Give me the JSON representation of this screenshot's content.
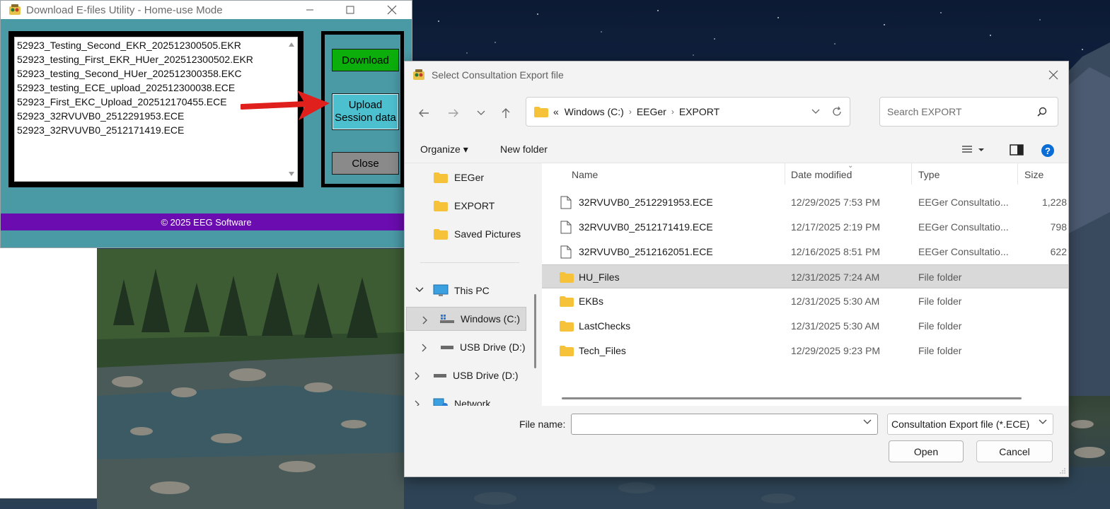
{
  "utility": {
    "title": "Download E-files Utility - Home-use Mode",
    "files": [
      "52923_Testing_Second_EKR_202512300505.EKR",
      "52923_testing_First_EKR_HUer_202512300502.EKR",
      "52923_testing_Second_HUer_202512300358.EKC",
      "52923_testing_ECE_upload_202512300038.ECE",
      "52923_First_EKC_Upload_202512170455.ECE",
      "52923_32RVUVB0_2512291953.ECE",
      "52923_32RVUVB0_2512171419.ECE"
    ],
    "download_label": "Download",
    "upload_label_1": "Upload",
    "upload_label_2": "Session data",
    "close_label": "Close",
    "footer": "© 2025 EEG Software",
    "colors": {
      "body": "#4a9aa6",
      "footer": "#6b0cb0",
      "download": "#0cae0c",
      "upload": "#4dc0d0",
      "arrow": "#e0201c"
    }
  },
  "dialog": {
    "title": "Select Consultation Export file",
    "breadcrumb": [
      "Windows (C:)",
      "EEGer",
      "EXPORT"
    ],
    "breadcrumb_prefix": "«",
    "search_placeholder": "Search EXPORT",
    "organize_label": "Organize ▾",
    "new_folder_label": "New folder",
    "nav_items": [
      {
        "label": "EEGer",
        "icon": "folder-icon"
      },
      {
        "label": "EXPORT",
        "icon": "folder-icon"
      },
      {
        "label": "Saved Pictures",
        "icon": "folder-icon"
      },
      {
        "label": "This PC",
        "icon": "computer-icon"
      },
      {
        "label": "Windows (C:)",
        "icon": "drive-icon"
      },
      {
        "label": "USB Drive (D:)",
        "icon": "usb-drive-icon"
      },
      {
        "label": "USB Drive (D:)",
        "icon": "usb-drive-icon"
      },
      {
        "label": "Network",
        "icon": "network-icon"
      }
    ],
    "columns": {
      "name": "Name",
      "date": "Date modified",
      "type": "Type",
      "size": "Size"
    },
    "rows": [
      {
        "name": "32RVUVB0_2512291953.ECE",
        "date": "12/29/2025 7:53 PM",
        "type": "EEGer Consultatio...",
        "size": "1,228",
        "icon": "file-icon"
      },
      {
        "name": "32RVUVB0_2512171419.ECE",
        "date": "12/17/2025 2:19 PM",
        "type": "EEGer Consultatio...",
        "size": "798",
        "icon": "file-icon"
      },
      {
        "name": "32RVUVB0_2512162051.ECE",
        "date": "12/16/2025 8:51 PM",
        "type": "EEGer Consultatio...",
        "size": "622",
        "icon": "file-icon"
      },
      {
        "name": "HU_Files",
        "date": "12/31/2025 7:24 AM",
        "type": "File folder",
        "size": "",
        "icon": "folder-icon"
      },
      {
        "name": "EKBs",
        "date": "12/31/2025 5:30 AM",
        "type": "File folder",
        "size": "",
        "icon": "folder-icon"
      },
      {
        "name": "LastChecks",
        "date": "12/31/2025 5:30 AM",
        "type": "File folder",
        "size": "",
        "icon": "folder-icon"
      },
      {
        "name": "Tech_Files",
        "date": "12/29/2025 9:23 PM",
        "type": "File folder",
        "size": "",
        "icon": "folder-icon"
      }
    ],
    "file_name_label": "File name:",
    "file_name_value": "",
    "filter_label": "Consultation Export file (*.ECE)",
    "open_label": "Open",
    "cancel_label": "Cancel",
    "colors": {
      "folder": "#f5c23a",
      "accent": "#0067c0",
      "selected": "#d9d9d9"
    }
  }
}
